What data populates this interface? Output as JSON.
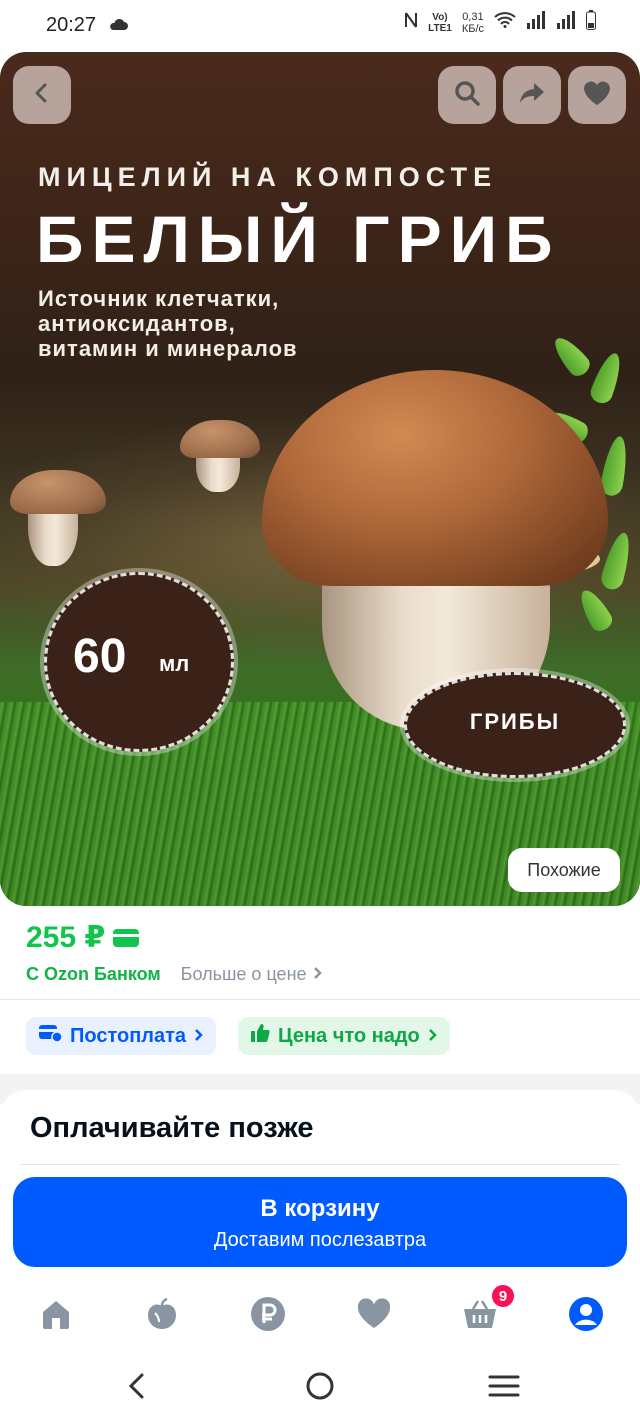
{
  "status_bar": {
    "time": "20:27",
    "network_label_top": "Vo)",
    "network_label_bottom": "LTE1",
    "speed_top": "0,31",
    "speed_bottom": "КБ/с"
  },
  "hero": {
    "line1": "МИЦЕЛИЙ НА КОМПОСТЕ",
    "line2": "БЕЛЫЙ ГРИБ",
    "description": [
      "Источник клетчатки,",
      "антиоксидантов,",
      "витамин и минералов"
    ],
    "volume_value": "60",
    "volume_unit": "мл",
    "category_badge": "ГРИБЫ",
    "similar_label": "Похожие",
    "back_icon": "back-arrow-icon",
    "search_icon": "search-icon",
    "share_icon": "share-icon",
    "favorite_icon": "heart-icon"
  },
  "price": {
    "amount": "255 ₽",
    "bank_label": "С Ozon Банком",
    "more_label": "Больше о цене"
  },
  "chips": {
    "postpay": "Постоплата",
    "fair_price": "Цена что надо"
  },
  "pay_later": {
    "title": "Оплачивайте позже"
  },
  "cart_button": {
    "label": "В корзину",
    "sublabel": "Доставим послезавтра"
  },
  "tabbar": {
    "cart_badge": "9",
    "items": [
      "home-icon",
      "fresh-icon",
      "ruble-icon",
      "favorites-icon",
      "cart-icon",
      "profile-icon"
    ]
  },
  "colors": {
    "accent_blue": "#005bff",
    "price_green": "#10c44c",
    "badge_pink": "#f91155"
  }
}
